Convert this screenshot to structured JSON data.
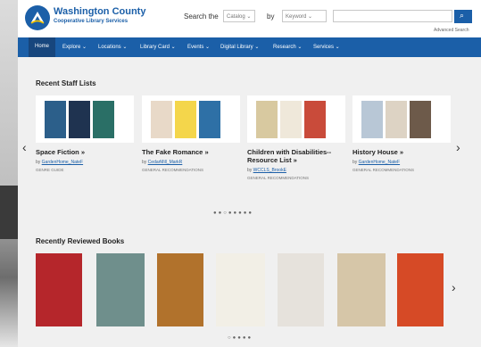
{
  "header": {
    "brand_name": "Washington County",
    "brand_subtitle": "Cooperative Library Services",
    "search_label": "Search the",
    "catalog_select": "Catalog ⌄",
    "by_label": "by",
    "keyword_select": "Keyword ⌄",
    "search_input_value": "",
    "search_button_icon": "search-icon",
    "advanced_search": "Advanced Search"
  },
  "nav": {
    "items": [
      "Home",
      "Explore ⌄",
      "Locations ⌄",
      "Library Card ⌄",
      "Events ⌄",
      "Digital Library ⌄",
      "Research ⌄",
      "Services ⌄"
    ]
  },
  "staff_lists": {
    "title": "Recent Staff Lists",
    "cards": [
      {
        "title": "Space Fiction »",
        "by": "by ",
        "author": "GardenHome_NateF",
        "tag": "GENRE GUIDE"
      },
      {
        "title": "The Fake Romance »",
        "by": "by ",
        "author": "CedarMill_MarkR",
        "tag": "GENERAL RECOMMENDATIONS"
      },
      {
        "title": "Children with Disabilities--Resource List »",
        "by": "by ",
        "author": "WCCLS_BrookE",
        "tag": "GENERAL RECOMMENDATIONS"
      },
      {
        "title": "History House »",
        "by": "by ",
        "author": "GardenHome_NateF",
        "tag": "GENERAL RECOMMENDATIONS"
      }
    ],
    "dots": "●●○●●●●●"
  },
  "reviewed": {
    "title": "Recently Reviewed Books",
    "dots": "○●●●●"
  },
  "colors": {
    "brand_blue": "#1b5fa8",
    "nav_active": "#17467d"
  }
}
